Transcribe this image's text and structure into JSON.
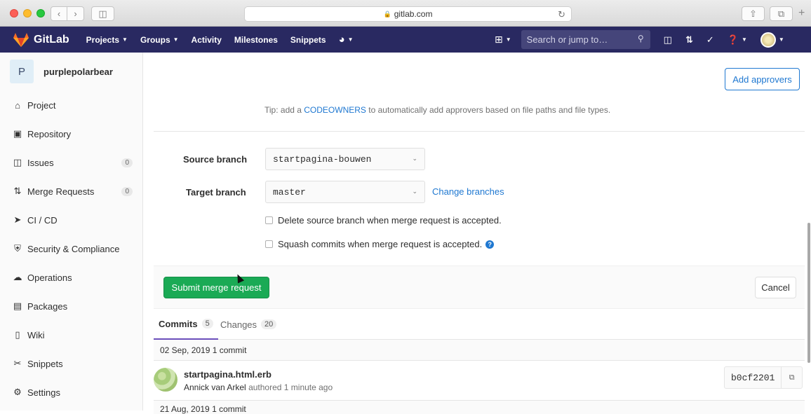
{
  "browser": {
    "url": "gitlab.com",
    "lock_icon": "lock-icon",
    "reload_icon": "reload-icon"
  },
  "topnav": {
    "brand": "GitLab",
    "items": [
      "Projects",
      "Groups",
      "Activity",
      "Milestones",
      "Snippets"
    ],
    "search_placeholder": "Search or jump to…",
    "accent": "#292961"
  },
  "sidebar": {
    "project_initial": "P",
    "project_name": "purplepolarbear",
    "items": [
      {
        "label": "Project",
        "icon": "home-icon"
      },
      {
        "label": "Repository",
        "icon": "repository-icon"
      },
      {
        "label": "Issues",
        "icon": "issues-icon",
        "count": "0"
      },
      {
        "label": "Merge Requests",
        "icon": "merge-request-icon",
        "count": "0"
      },
      {
        "label": "CI / CD",
        "icon": "rocket-icon"
      },
      {
        "label": "Security & Compliance",
        "icon": "shield-icon"
      },
      {
        "label": "Operations",
        "icon": "cloud-icon"
      },
      {
        "label": "Packages",
        "icon": "package-icon"
      },
      {
        "label": "Wiki",
        "icon": "book-icon"
      },
      {
        "label": "Snippets",
        "icon": "scissors-icon"
      },
      {
        "label": "Settings",
        "icon": "gear-icon"
      }
    ]
  },
  "form": {
    "add_approvers": "Add approvers",
    "tip_prefix": "Tip: add a",
    "tip_link": "CODEOWNERS",
    "tip_suffix": "to automatically add approvers based on file paths and file types.",
    "source_label": "Source branch",
    "source_value": "startpagina-bouwen",
    "target_label": "Target branch",
    "target_value": "master",
    "change_branches": "Change branches",
    "delete_source": "Delete source branch when merge request is accepted.",
    "squash": "Squash commits when merge request is accepted.",
    "submit": "Submit merge request",
    "cancel": "Cancel"
  },
  "tabs": {
    "commits_label": "Commits",
    "commits_count": "5",
    "changes_label": "Changes",
    "changes_count": "20"
  },
  "commits": {
    "day1": "02 Sep, 2019 1 commit",
    "title": "startpagina.html.erb",
    "author": "Annick van Arkel",
    "meta": "authored 1 minute ago",
    "sha": "b0cf2201",
    "day2": "21 Aug, 2019 1 commit"
  },
  "colors": {
    "primary_link": "#1f78d1",
    "submit_green": "#1aaa55",
    "active_tab": "#6b4fbb"
  }
}
